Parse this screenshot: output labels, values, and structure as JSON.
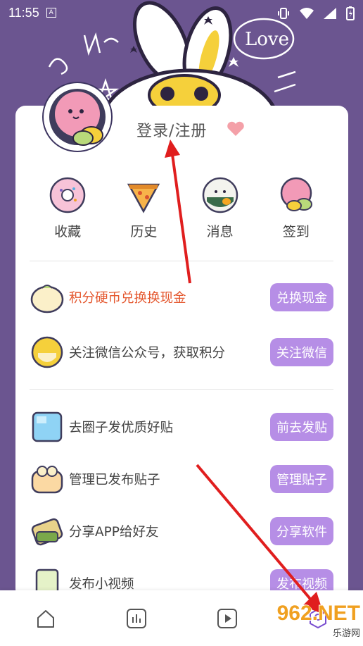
{
  "status_bar": {
    "time": "11:55",
    "a_badge": "A"
  },
  "header": {
    "login_label": "登录/注册"
  },
  "quick_actions": [
    {
      "label": "收藏",
      "icon": "donut-icon"
    },
    {
      "label": "历史",
      "icon": "pizza-icon"
    },
    {
      "label": "消息",
      "icon": "sushi-icon"
    },
    {
      "label": "签到",
      "icon": "macaron-icon"
    }
  ],
  "tasks": [
    {
      "text": "积分硬币兑换换现金",
      "button": "兑换现金",
      "highlight": true
    },
    {
      "text": "关注微信公众号，获取积分",
      "button": "关注微信",
      "highlight": false
    },
    {
      "text": "去圈子发优质好贴",
      "button": "前去发贴",
      "highlight": false
    },
    {
      "text": "管理已发布贴子",
      "button": "管理贴子",
      "highlight": false
    },
    {
      "text": "分享APP给好友",
      "button": "分享软件",
      "highlight": false
    },
    {
      "text": "发布小视频",
      "button": "发布视频",
      "highlight": false
    }
  ],
  "bottom_nav": [
    {
      "name": "home-icon"
    },
    {
      "name": "chart-icon"
    },
    {
      "name": "play-icon"
    },
    {
      "name": "profile-icon"
    }
  ],
  "watermark": {
    "main": "962.NET",
    "sub": "乐游网"
  },
  "colors": {
    "header_bg": "#6b5590",
    "button": "#b68ee6",
    "highlight_text": "#e4572e",
    "arrow": "#e01e1e"
  }
}
